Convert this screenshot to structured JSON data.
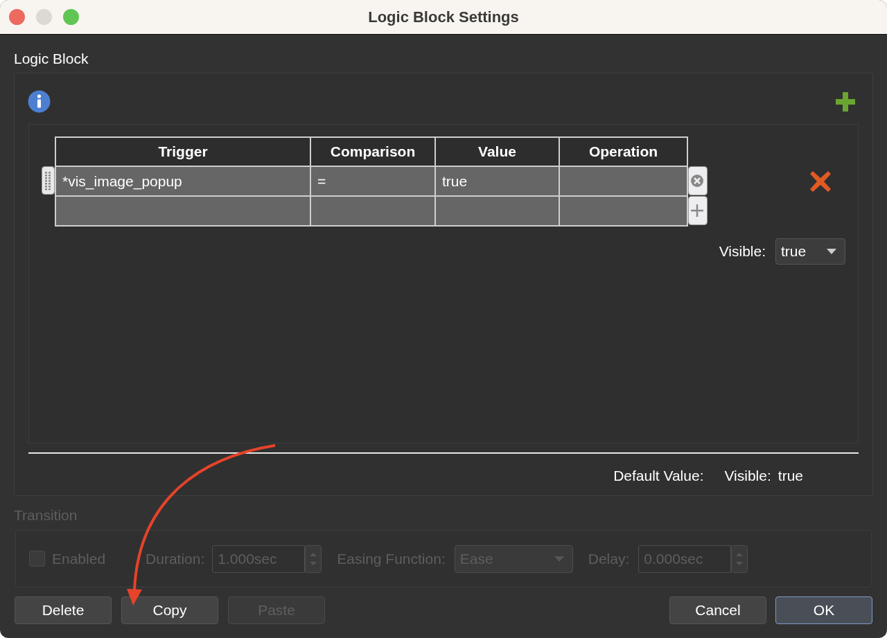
{
  "window": {
    "title": "Logic Block Settings"
  },
  "logic_block": {
    "label": "Logic Block",
    "table": {
      "columns": [
        "Trigger",
        "Comparison",
        "Value",
        "Operation"
      ],
      "rows": [
        {
          "kind": "condition",
          "cells": [
            "*vis_image_popup",
            "=",
            "true"
          ]
        },
        {
          "kind": "new"
        }
      ]
    },
    "visible": {
      "label": "Visible:",
      "value": "true"
    },
    "default_value": {
      "label": "Default Value:",
      "property": "Visible:",
      "value": "true"
    }
  },
  "transition": {
    "label": "Transition",
    "disabled": true,
    "enabled": {
      "label": "Enabled",
      "checked": false
    },
    "duration": {
      "label": "Duration:",
      "value": "1.000sec"
    },
    "easing": {
      "label": "Easing Function:",
      "value": "Ease"
    },
    "delay": {
      "label": "Delay:",
      "value": "0.000sec"
    }
  },
  "left_buttons": [
    {
      "label": "Delete",
      "disabled": false,
      "default": false
    },
    {
      "label": "Copy",
      "disabled": false,
      "default": false
    },
    {
      "label": "Paste",
      "disabled": true,
      "default": false
    }
  ],
  "right_buttons": [
    {
      "label": "Cancel",
      "disabled": false,
      "default": false
    },
    {
      "label": "OK",
      "disabled": false,
      "default": true
    }
  ]
}
